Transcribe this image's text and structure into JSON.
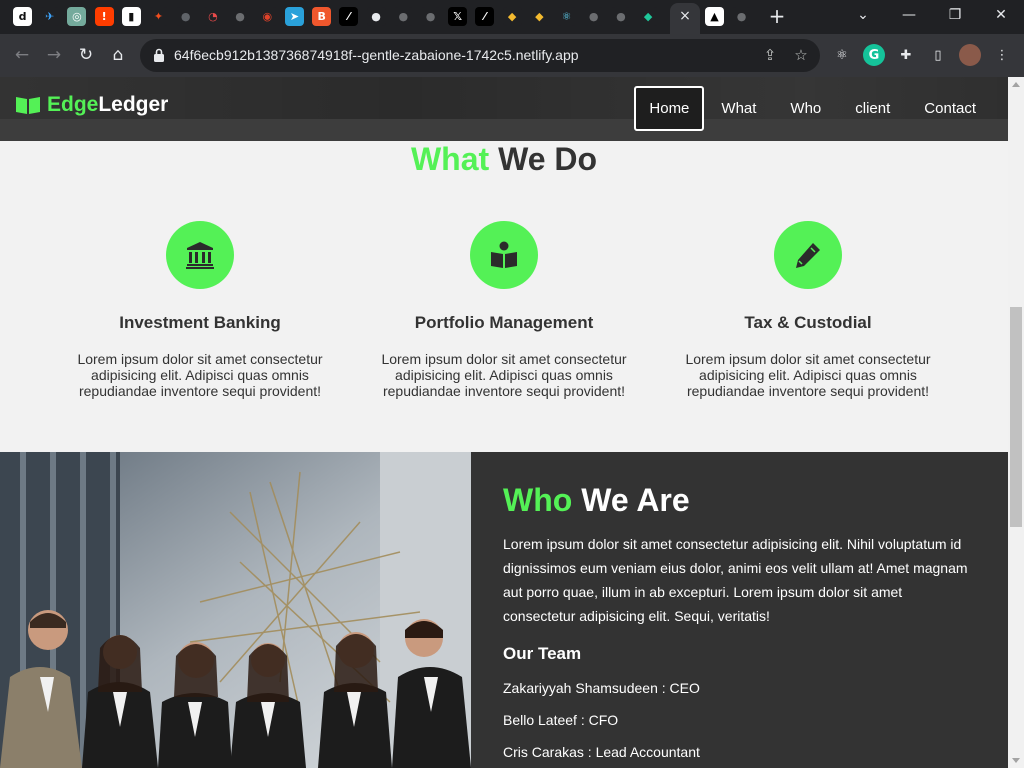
{
  "browser": {
    "url": "64f6ecb912b138736874918f--gentle-zabaione-1742c5.netlify.app",
    "tab_close_symbol": "×",
    "new_tab_symbol": "+",
    "tab_icons": [
      {
        "name": "dribbble-like-icon",
        "glyph": "d",
        "bg": "#ffffff",
        "fg": "#111111"
      },
      {
        "name": "bird-app-icon",
        "glyph": "✈",
        "bg": "#202124",
        "fg": "#3ea6ff"
      },
      {
        "name": "chatgpt-icon",
        "glyph": "◎",
        "bg": "#74aa9c",
        "fg": "#ffffff"
      },
      {
        "name": "alert-app-icon",
        "glyph": "!",
        "bg": "#ff3d00",
        "fg": "#ffffff"
      },
      {
        "name": "trello-icon",
        "glyph": "▮",
        "bg": "#ffffff",
        "fg": "#111111"
      },
      {
        "name": "figma-icon",
        "glyph": "✦",
        "bg": "#202124",
        "fg": "#f24e1e"
      },
      {
        "name": "github-icon",
        "glyph": "●",
        "bg": "#202124",
        "fg": "#5f6368"
      },
      {
        "name": "speed-test-icon",
        "glyph": "◔",
        "bg": "#202124",
        "fg": "#e84a4a"
      },
      {
        "name": "globe-icon",
        "glyph": "●",
        "bg": "#202124",
        "fg": "#6b6d70"
      },
      {
        "name": "chrome-icon",
        "glyph": "◉",
        "bg": "#202124",
        "fg": "#e2432a"
      },
      {
        "name": "telegram-icon",
        "glyph": "➤",
        "bg": "#2aa1da",
        "fg": "#ffffff"
      },
      {
        "name": "brave-icon",
        "glyph": "B",
        "bg": "#f0572d",
        "fg": "#ffffff"
      },
      {
        "name": "link-app-icon",
        "glyph": "⁄",
        "bg": "#000000",
        "fg": "#ffffff"
      },
      {
        "name": "github-icon",
        "glyph": "●",
        "bg": "#202124",
        "fg": "#e8eaed"
      },
      {
        "name": "globe-icon",
        "glyph": "●",
        "bg": "#202124",
        "fg": "#6b6d70"
      },
      {
        "name": "globe-icon",
        "glyph": "●",
        "bg": "#202124",
        "fg": "#6b6d70"
      },
      {
        "name": "x-twitter-icon",
        "glyph": "𝕏",
        "bg": "#000000",
        "fg": "#ffffff"
      },
      {
        "name": "link-app-icon",
        "glyph": "⁄",
        "bg": "#000000",
        "fg": "#ffffff"
      },
      {
        "name": "binance-icon",
        "glyph": "◆",
        "bg": "#202124",
        "fg": "#f3ba2f"
      },
      {
        "name": "binance-icon",
        "glyph": "◆",
        "bg": "#202124",
        "fg": "#f3ba2f"
      },
      {
        "name": "react-icon",
        "glyph": "⚛",
        "bg": "#202124",
        "fg": "#61dafb"
      },
      {
        "name": "globe-icon",
        "glyph": "●",
        "bg": "#202124",
        "fg": "#6b6d70"
      },
      {
        "name": "globe-icon",
        "glyph": "●",
        "bg": "#202124",
        "fg": "#6b6d70"
      },
      {
        "name": "edge-green-icon",
        "glyph": "◆",
        "bg": "#202124",
        "fg": "#1fc79a"
      }
    ],
    "right_tab_icons": [
      {
        "name": "vercel-icon",
        "glyph": "▲",
        "bg": "#ffffff",
        "fg": "#000000"
      },
      {
        "name": "globe-icon",
        "glyph": "●",
        "bg": "#202124",
        "fg": "#6b6d70"
      }
    ]
  },
  "site": {
    "logo_part1": "Edge",
    "logo_part2": "Ledger",
    "nav": [
      {
        "label": "Home"
      },
      {
        "label": "What"
      },
      {
        "label": "Who"
      },
      {
        "label": "client"
      },
      {
        "label": "Contact"
      }
    ]
  },
  "what": {
    "title_accent": "What",
    "title_rest": " We Do",
    "features": [
      {
        "icon": "bank-icon",
        "title": "Investment Banking",
        "text": "Lorem ipsum dolor sit amet consectetur adipisicing elit. Adipisci quas omnis repudiandae inventore sequi provident!"
      },
      {
        "icon": "book-reader-icon",
        "title": "Portfolio Management",
        "text": "Lorem ipsum dolor sit amet consectetur adipisicing elit. Adipisci quas omnis repudiandae inventore sequi provident!"
      },
      {
        "icon": "pencil-icon",
        "title": "Tax & Custodial",
        "text": "Lorem ipsum dolor sit amet consectetur adipisicing elit. Adipisci quas omnis repudiandae inventore sequi provident!"
      }
    ]
  },
  "who": {
    "title_accent": "Who",
    "title_rest": " We Are",
    "text": "Lorem ipsum dolor sit amet consectetur adipisicing elit. Nihil voluptatum id dignissimos eum veniam eius dolor, animi eos velit ullam at! Amet magnam aut porro quae, illum in ab excepturi. Lorem ipsum dolor sit amet consectetur adipisicing elit. Sequi, veritatis!",
    "team_heading": "Our Team",
    "team": [
      "Zakariyyah Shamsudeen : CEO",
      "Bello Lateef : CFO",
      "Cris Carakas : Lead Accountant"
    ]
  },
  "colors": {
    "accent": "#54f156",
    "dark": "#333333",
    "nav_bg": "#2b2b2b"
  }
}
